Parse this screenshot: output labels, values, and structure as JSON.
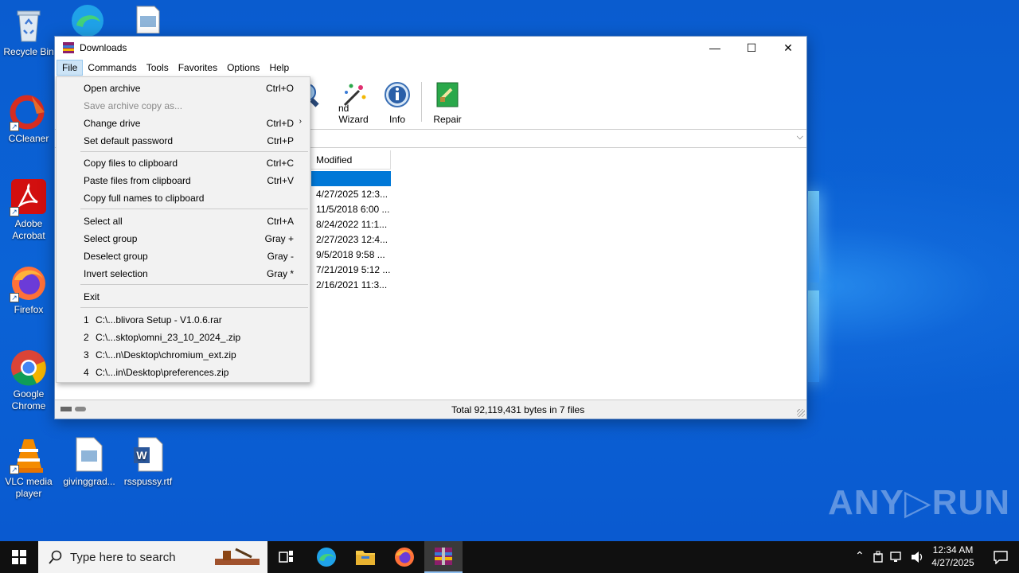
{
  "desktop": {
    "icons": [
      {
        "label": "Recycle Bin"
      },
      {
        "label": "CCleaner"
      },
      {
        "label": "Adobe Acrobat"
      },
      {
        "label": "Firefox"
      },
      {
        "label": "Google Chrome"
      },
      {
        "label": "VLC media player"
      },
      {
        "label": "givinggrad..."
      },
      {
        "label": "rsspussy.rtf"
      }
    ],
    "watermark": "ANY▷RUN"
  },
  "window": {
    "title": "Downloads",
    "menus": [
      "File",
      "Commands",
      "Tools",
      "Favorites",
      "Options",
      "Help"
    ],
    "toolbar": [
      {
        "label": "nd"
      },
      {
        "label": "Wizard"
      },
      {
        "label": "Info"
      },
      {
        "label": "Repair"
      }
    ],
    "column_modified": "Modified",
    "rows": [
      "",
      "4/27/2025 12:3...",
      "11/5/2018 6:00 ...",
      "8/24/2022 11:1...",
      "2/27/2023 12:4...",
      "9/5/2018 9:58 ...",
      "7/21/2019 5:12 ...",
      "2/16/2021 11:3..."
    ],
    "status": "Total 92,119,431 bytes in 7 files"
  },
  "file_menu": {
    "items": [
      {
        "label": "Open archive",
        "shortcut": "Ctrl+O"
      },
      {
        "label": "Save archive copy as...",
        "shortcut": ""
      },
      {
        "label": "Change drive",
        "shortcut": "Ctrl+D"
      },
      {
        "label": "Set default password",
        "shortcut": "Ctrl+P"
      },
      {
        "label": "Copy files to clipboard",
        "shortcut": "Ctrl+C"
      },
      {
        "label": "Paste files from clipboard",
        "shortcut": "Ctrl+V"
      },
      {
        "label": "Copy full names to clipboard",
        "shortcut": ""
      },
      {
        "label": "Select all",
        "shortcut": "Ctrl+A"
      },
      {
        "label": "Select group",
        "shortcut": "Gray +"
      },
      {
        "label": "Deselect group",
        "shortcut": "Gray -"
      },
      {
        "label": "Invert selection",
        "shortcut": "Gray *"
      },
      {
        "label": "Exit",
        "shortcut": ""
      }
    ],
    "recent": [
      {
        "num": "1",
        "path": "C:\\...blivora Setup - V1.0.6.rar"
      },
      {
        "num": "2",
        "path": "C:\\...sktop\\omni_23_10_2024_.zip"
      },
      {
        "num": "3",
        "path": "C:\\...n\\Desktop\\chromium_ext.zip"
      },
      {
        "num": "4",
        "path": "C:\\...in\\Desktop\\preferences.zip"
      }
    ]
  },
  "taskbar": {
    "search_placeholder": "Type here to search",
    "time": "12:34 AM",
    "date": "4/27/2025"
  }
}
